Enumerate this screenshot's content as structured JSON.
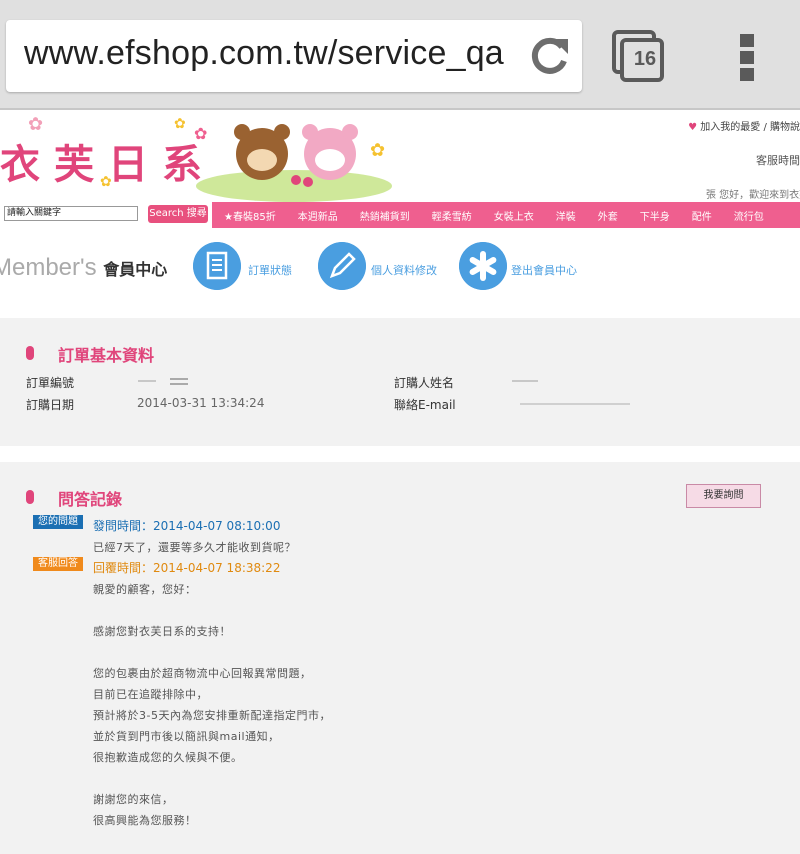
{
  "browser": {
    "url": "www.efshop.com.tw/service_qa",
    "tab_count": "16"
  },
  "header": {
    "logo_text": "衣芙日系",
    "top_links": "加入我的最愛 / 購物說",
    "service_text": "客服時間",
    "welcome_text": "張 您好，歡迎來到衣芙"
  },
  "search": {
    "placeholder": "請輸入關鍵字",
    "button_label": "Search 搜尋"
  },
  "nav": {
    "items": [
      "★春裝85折",
      "本週新品",
      "熱銷補貨到",
      "輕柔雪紡",
      "女裝上衣",
      "洋裝",
      "外套",
      "下半身",
      "配件",
      "流行包"
    ]
  },
  "member": {
    "title_en": "Member's",
    "title_zh": "會員中心",
    "buttons": [
      "訂單狀態",
      "個人資料修改",
      "登出會員中心"
    ]
  },
  "order": {
    "section_title": "訂單基本資料",
    "order_no_label": "訂單編號",
    "order_date_label": "訂購日期",
    "order_date": "2014-03-31 13:34:24",
    "buyer_name_label": "訂購人姓名",
    "email_label": "聯絡E-mail"
  },
  "qa": {
    "section_title": "問答記錄",
    "ask_button": "我要詢問",
    "question_tag": "您的問題",
    "question_time": "發問時間：2014-04-07 08:10:00",
    "question_text": "已經7天了，還要等多久才能收到貨呢？",
    "answer_tag": "客服回答",
    "answer_time": "回覆時間：2014-04-07 18:38:22",
    "answer_lines": [
      "親愛的顧客，您好：",
      "",
      "感謝您對衣芙日系的支持！",
      "",
      "您的包裹由於超商物流中心回報異常問題，",
      "目前已在追蹤排除中，",
      "預計將於3-5天內為您安排重新配達指定門市，",
      "並於貨到門市後以簡訊與mail通知，",
      "很抱歉造成您的久候與不便。",
      "",
      "謝謝您的來信，",
      "很高興能為您服務！"
    ]
  },
  "colors": {
    "brand_pink": "#e0457b",
    "nav_pink": "#ef5f8f",
    "member_blue": "#4a9ee0",
    "question_blue": "#1b6fb3",
    "answer_orange": "#f08a1c"
  }
}
